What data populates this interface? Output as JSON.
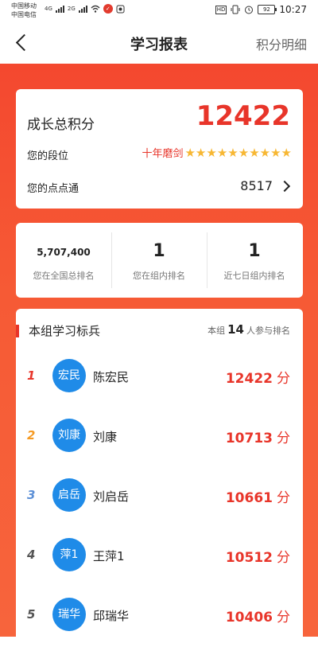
{
  "status_bar": {
    "carrier_1": "中国移动",
    "carrier_2": "中国电信",
    "network_1": "4G",
    "network_2": "2G",
    "hd": "HD",
    "battery": "92",
    "time": "10:27"
  },
  "header": {
    "title": "学习报表",
    "right_link": "积分明细"
  },
  "growth": {
    "label": "成长总积分",
    "score": "12422",
    "rank_label": "您的段位",
    "rank_value": "十年磨剑",
    "stars": 10,
    "diandian_label": "您的点点通",
    "diandian_value": "8517"
  },
  "rankings": [
    {
      "value": "5,707,400",
      "label": "您在全国总排名"
    },
    {
      "value": "1",
      "label": "您在组内排名"
    },
    {
      "value": "1",
      "label": "近七日组内排名"
    }
  ],
  "group": {
    "title": "本组学习标兵",
    "meta_prefix": "本组",
    "meta_count": "14",
    "meta_suffix": "人参与排名",
    "unit": "分",
    "members": [
      {
        "rank": "1",
        "avatar": "宏民",
        "name": "陈宏民",
        "score": "12422",
        "rank_color": "#e8352a"
      },
      {
        "rank": "2",
        "avatar": "刘康",
        "name": "刘康",
        "score": "10713",
        "rank_color": "#f59a23"
      },
      {
        "rank": "3",
        "avatar": "启岳",
        "name": "刘启岳",
        "score": "10661",
        "rank_color": "#5b8fd6"
      },
      {
        "rank": "4",
        "avatar": "萍1",
        "name": "王萍1",
        "score": "10512",
        "rank_color": "#555555"
      },
      {
        "rank": "5",
        "avatar": "瑞华",
        "name": "邱瑞华",
        "score": "10406",
        "rank_color": "#555555"
      }
    ]
  },
  "colors": {
    "accent": "#e8352a",
    "background_red": "#f65a35",
    "avatar_blue": "#1f8be8",
    "star_gold": "#f7b733"
  },
  "icons": {
    "back": "chevron-left-icon",
    "more": "chevron-right-icon",
    "star": "star-icon"
  }
}
